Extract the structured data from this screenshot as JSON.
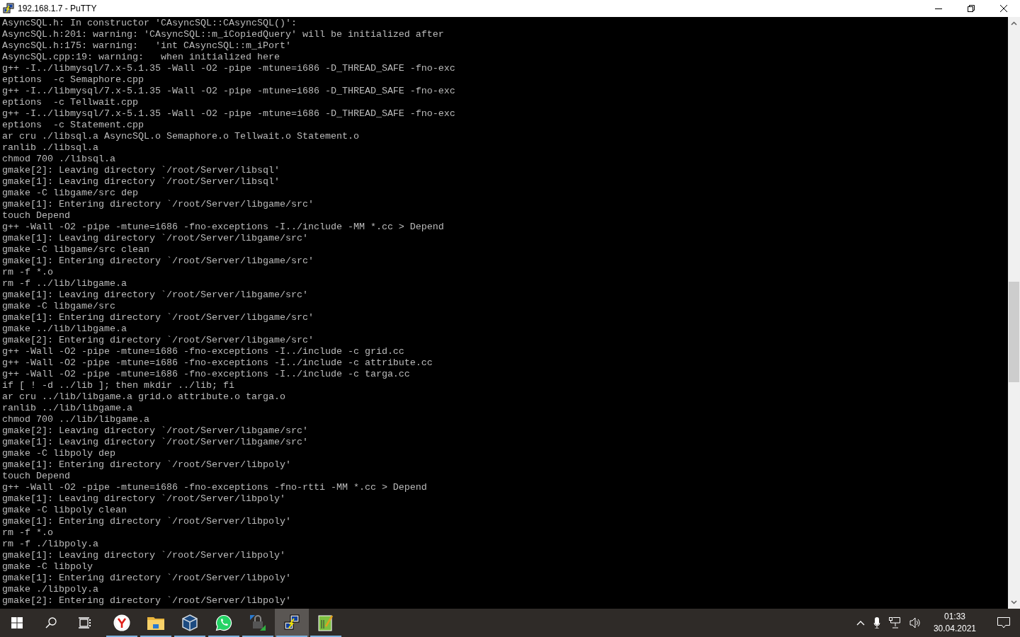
{
  "window": {
    "title": "192.168.1.7 - PuTTY"
  },
  "terminal": {
    "lines": [
      "AsyncSQL.h: In constructor 'CAsyncSQL::CAsyncSQL()':",
      "AsyncSQL.h:201: warning: 'CAsyncSQL::m_iCopiedQuery' will be initialized after",
      "AsyncSQL.h:175: warning:   'int CAsyncSQL::m_iPort'",
      "AsyncSQL.cpp:19: warning:   when initialized here",
      "g++ -I../libmysql/7.x-5.1.35 -Wall -O2 -pipe -mtune=i686 -D_THREAD_SAFE -fno-exc",
      "eptions  -c Semaphore.cpp",
      "g++ -I../libmysql/7.x-5.1.35 -Wall -O2 -pipe -mtune=i686 -D_THREAD_SAFE -fno-exc",
      "eptions  -c Tellwait.cpp",
      "g++ -I../libmysql/7.x-5.1.35 -Wall -O2 -pipe -mtune=i686 -D_THREAD_SAFE -fno-exc",
      "eptions  -c Statement.cpp",
      "ar cru ./libsql.a AsyncSQL.o Semaphore.o Tellwait.o Statement.o",
      "ranlib ./libsql.a",
      "chmod 700 ./libsql.a",
      "gmake[2]: Leaving directory `/root/Server/libsql'",
      "gmake[1]: Leaving directory `/root/Server/libsql'",
      "gmake -C libgame/src dep",
      "gmake[1]: Entering directory `/root/Server/libgame/src'",
      "touch Depend",
      "g++ -Wall -O2 -pipe -mtune=i686 -fno-exceptions -I../include -MM *.cc > Depend",
      "gmake[1]: Leaving directory `/root/Server/libgame/src'",
      "gmake -C libgame/src clean",
      "gmake[1]: Entering directory `/root/Server/libgame/src'",
      "rm -f *.o",
      "rm -f ../lib/libgame.a",
      "gmake[1]: Leaving directory `/root/Server/libgame/src'",
      "gmake -C libgame/src",
      "gmake[1]: Entering directory `/root/Server/libgame/src'",
      "gmake ../lib/libgame.a",
      "gmake[2]: Entering directory `/root/Server/libgame/src'",
      "g++ -Wall -O2 -pipe -mtune=i686 -fno-exceptions -I../include -c grid.cc",
      "g++ -Wall -O2 -pipe -mtune=i686 -fno-exceptions -I../include -c attribute.cc",
      "g++ -Wall -O2 -pipe -mtune=i686 -fno-exceptions -I../include -c targa.cc",
      "if [ ! -d ../lib ]; then mkdir ../lib; fi",
      "ar cru ../lib/libgame.a grid.o attribute.o targa.o",
      "ranlib ../lib/libgame.a",
      "chmod 700 ../lib/libgame.a",
      "gmake[2]: Leaving directory `/root/Server/libgame/src'",
      "gmake[1]: Leaving directory `/root/Server/libgame/src'",
      "gmake -C libpoly dep",
      "gmake[1]: Entering directory `/root/Server/libpoly'",
      "touch Depend",
      "g++ -Wall -O2 -pipe -mtune=i686 -fno-exceptions -fno-rtti -MM *.cc > Depend",
      "gmake[1]: Leaving directory `/root/Server/libpoly'",
      "gmake -C libpoly clean",
      "gmake[1]: Entering directory `/root/Server/libpoly'",
      "rm -f *.o",
      "rm -f ./libpoly.a",
      "gmake[1]: Leaving directory `/root/Server/libpoly'",
      "gmake -C libpoly",
      "gmake[1]: Entering directory `/root/Server/libpoly'",
      "gmake ./libpoly.a",
      "gmake[2]: Entering directory `/root/Server/libpoly'"
    ]
  },
  "taskbar": {
    "apps": [
      {
        "kind": "browser",
        "running": true,
        "selected": false
      },
      {
        "kind": "folder",
        "running": true,
        "selected": false
      },
      {
        "kind": "cube",
        "running": true,
        "selected": false
      },
      {
        "kind": "chat",
        "running": true,
        "selected": false
      },
      {
        "kind": "lock",
        "running": true,
        "selected": false
      },
      {
        "kind": "terminal",
        "running": true,
        "selected": true
      },
      {
        "kind": "notepad",
        "running": true,
        "selected": false
      }
    ],
    "clock": {
      "time": "01:33",
      "date": "30.04.2021"
    }
  }
}
